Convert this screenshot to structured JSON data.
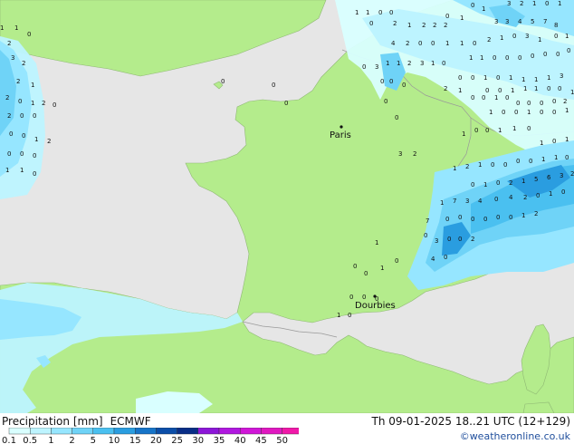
{
  "map": {
    "cities": [
      {
        "name": "Paris"
      },
      {
        "name": "Dourbies"
      }
    ],
    "precip_values": [
      "1",
      "1",
      "0",
      "0",
      "1",
      "1",
      "0",
      "2",
      "3",
      "2",
      "2",
      "1",
      "2",
      "0",
      "2",
      "0",
      "1",
      "2",
      "0",
      "0",
      "0",
      "0",
      "1",
      "2",
      "0",
      "0",
      "0",
      "1",
      "1",
      "0",
      "0",
      "0",
      "0",
      "0",
      "2",
      "3",
      "2",
      "1",
      "0",
      "1",
      "0",
      "1",
      "0",
      "1",
      "1",
      "2",
      "2",
      "2",
      "3",
      "3",
      "4",
      "5",
      "7",
      "8",
      "4",
      "2",
      "0",
      "0",
      "1",
      "1",
      "0",
      "2",
      "1",
      "0",
      "3",
      "1",
      "0",
      "1",
      "0",
      "3",
      "1",
      "1",
      "2",
      "3",
      "1",
      "0",
      "1",
      "1",
      "0",
      "0",
      "0",
      "0",
      "0",
      "0",
      "0",
      "0",
      "0",
      "0",
      "0",
      "0",
      "1",
      "0",
      "1",
      "1",
      "1",
      "1",
      "3",
      "2",
      "1",
      "0",
      "0",
      "1",
      "1",
      "1",
      "0",
      "0",
      "1",
      "0",
      "0",
      "0",
      "0",
      "1",
      "0",
      "0",
      "0",
      "0",
      "0",
      "2",
      "1",
      "0",
      "0",
      "1",
      "0",
      "0",
      "1",
      "3",
      "2",
      "1",
      "0",
      "0",
      "1",
      "1",
      "0",
      "1",
      "0",
      "1",
      "1",
      "2",
      "1",
      "0",
      "0",
      "0",
      "0",
      "1",
      "1",
      "0",
      "0",
      "1",
      "0",
      "2",
      "1",
      "5",
      "6",
      "3",
      "2",
      "1",
      "7",
      "3",
      "4",
      "0",
      "4",
      "2",
      "0",
      "1",
      "0",
      "0",
      "0",
      "0",
      "0",
      "0",
      "0",
      "1",
      "2",
      "7",
      "3",
      "0",
      "0",
      "2",
      "4",
      "0",
      "0",
      "1",
      "1",
      "0",
      "0",
      "0",
      "0",
      "0",
      "0",
      "1",
      "0"
    ],
    "colors": {
      "land": "#b4ec8c",
      "sea": "#e6e6e6",
      "border": "#aaaaaa"
    }
  },
  "legend": {
    "title": "Precipitation [mm]",
    "model": "ECMWF",
    "datetime": "Th 09-01-2025 18..21 UTC (12+129)",
    "credit": "©weatheronline.co.uk",
    "ticks": [
      "0.1",
      "0.5",
      "1",
      "2",
      "5",
      "10",
      "15",
      "20",
      "25",
      "30",
      "35",
      "40",
      "45",
      "50"
    ],
    "colors": [
      "#d9ffff",
      "#bdf4ff",
      "#96e6ff",
      "#6fd3f7",
      "#4ac0f0",
      "#2a9de0",
      "#1674c8",
      "#0b4ea8",
      "#082d86",
      "#8c16d8",
      "#b018e0",
      "#d016d8",
      "#e018c0",
      "#f018a8"
    ]
  }
}
